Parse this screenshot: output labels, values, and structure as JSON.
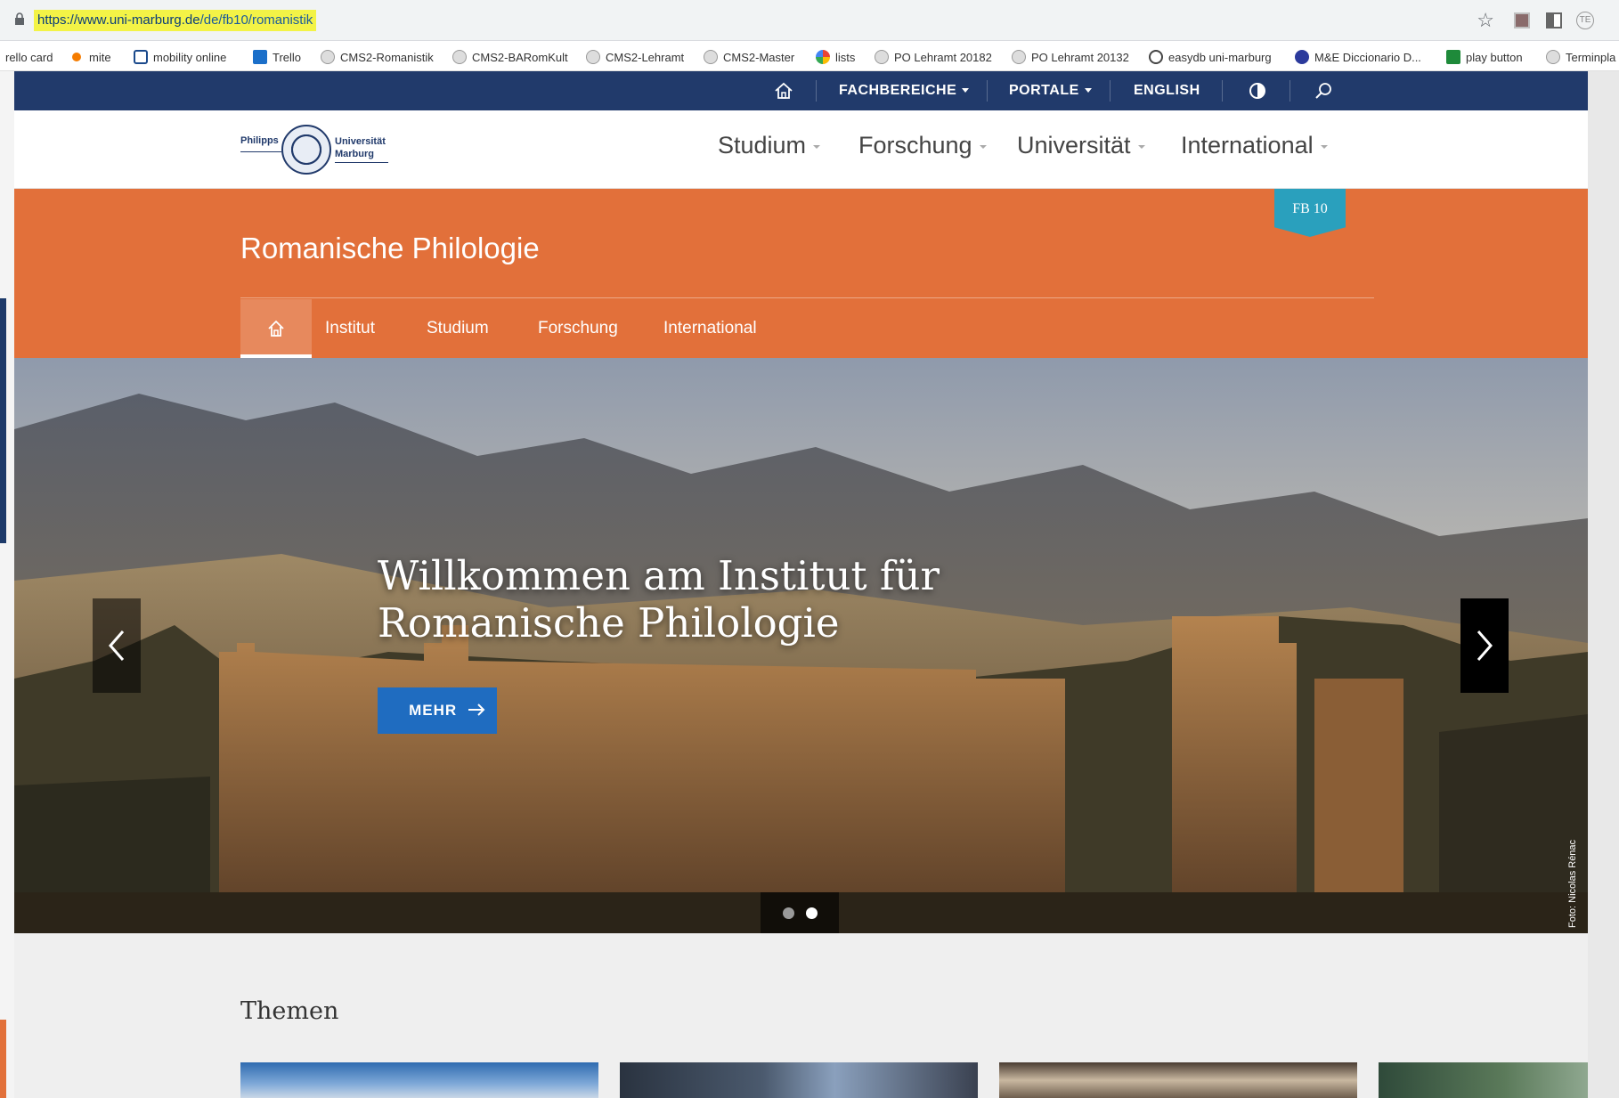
{
  "browser": {
    "url_domain": "https://www.uni-marburg.de",
    "url_path": "/de/fb10/romanistik",
    "extension_3_label": "TE",
    "bookmarks": [
      {
        "label": "rello card",
        "icon": "none"
      },
      {
        "label": "mite",
        "icon": "orange-dot-icon"
      },
      {
        "label": "mobility online",
        "icon": "mobility-icon"
      },
      {
        "label": "Trello",
        "icon": "trello-icon"
      },
      {
        "label": "CMS2-Romanistik",
        "icon": "cms-icon"
      },
      {
        "label": "CMS2-BARomKult",
        "icon": "cms-icon"
      },
      {
        "label": "CMS2-Lehramt",
        "icon": "cms-icon"
      },
      {
        "label": "CMS2-Master",
        "icon": "cms-icon"
      },
      {
        "label": "lists",
        "icon": "lists-icon"
      },
      {
        "label": "PO Lehramt 20182",
        "icon": "cms-icon"
      },
      {
        "label": "PO Lehramt 20132",
        "icon": "cms-icon"
      },
      {
        "label": "easydb uni-marburg",
        "icon": "easydb-icon"
      },
      {
        "label": "M&E Diccionario D...",
        "icon": "me-icon"
      },
      {
        "label": "play button",
        "icon": "play-icon"
      },
      {
        "label": "Terminpla",
        "icon": "cms-icon"
      }
    ]
  },
  "top_nav": {
    "fachbereiche": "FACHBEREICHE",
    "portale": "PORTALE",
    "english": "ENGLISH"
  },
  "header": {
    "logo_left": "Philipps",
    "logo_right_1": "Universität",
    "logo_right_2": "Marburg",
    "nav": [
      "Studium",
      "Forschung",
      "Universität",
      "International"
    ]
  },
  "faculty": {
    "title": "Romanische Philologie",
    "badge": "FB 10",
    "subnav": [
      "Institut",
      "Studium",
      "Forschung",
      "International"
    ]
  },
  "hero": {
    "title": "Willkommen am Institut für Romanische Philologie",
    "button_label": "MEHR",
    "photo_credit": "Foto: Nicolas Rénac",
    "active_slide": 2,
    "slide_count": 2
  },
  "themen": {
    "title": "Themen"
  },
  "colors": {
    "top_nav_bg": "#213a6b",
    "faculty_orange": "#e2703a",
    "badge_teal": "#2aa0bd",
    "button_blue": "#1f6cc0",
    "url_highlight": "#f3f346"
  }
}
